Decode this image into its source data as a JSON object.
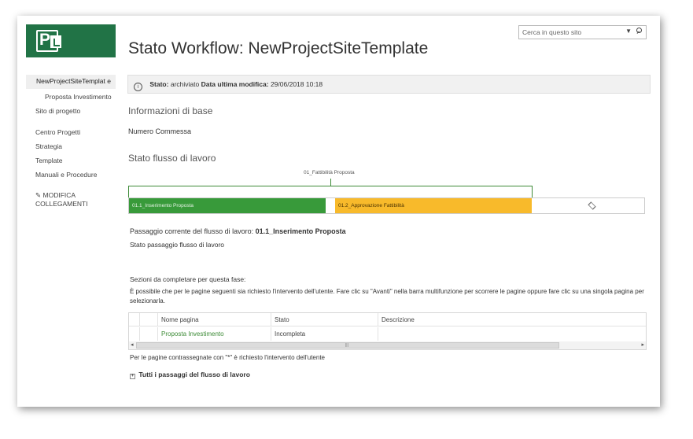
{
  "search": {
    "placeholder": "Cerca in questo sito"
  },
  "page": {
    "title": "Stato Workflow: NewProjectSiteTemplate"
  },
  "nav": {
    "items": [
      {
        "label": "NewProjectSiteTemplat e"
      },
      {
        "label": "Proposta Investimento"
      },
      {
        "label": "Sito di progetto"
      },
      {
        "label": "Centro Progetti"
      },
      {
        "label": "Strategia"
      },
      {
        "label": "Template"
      },
      {
        "label": "Manuali e Procedure"
      }
    ],
    "edit_links": "MODIFICA COLLEGAMENTI"
  },
  "status": {
    "label": "Stato:",
    "value": "archiviato",
    "modified_label": "Data ultima modifica:",
    "modified_value": "29/06/2018 10:18"
  },
  "basic_info": {
    "heading": "Informazioni di base",
    "field_link": "Numero Commessa"
  },
  "workflow": {
    "heading": "Stato flusso di lavoro",
    "callout": "01_Fattibilità Proposta",
    "stages": [
      {
        "label": "01.1_Inserimento Proposta",
        "color": "#389a3a"
      },
      {
        "label": "01.2_Approvazione Fattibilità",
        "color": "#f8ba2b"
      }
    ],
    "current_label": "Passaggio corrente del flusso di lavoro:",
    "current_value": "01.1_Inserimento Proposta",
    "status_label": "Stato passaggio flusso di lavoro"
  },
  "sections": {
    "heading": "Sezioni da completare per questa fase:",
    "description": "È possibile che per le pagine seguenti sia richiesto l'intervento dell'utente. Fare clic su \"Avanti\" nella barra multifunzione per scorrere le pagine oppure fare clic su una singola pagina per selezionarla.",
    "columns": [
      "Nome pagina",
      "Stato",
      "Descrizione"
    ],
    "rows": [
      {
        "name": "Proposta Investimento",
        "status": "Incompleta",
        "description": ""
      }
    ],
    "footnote": "Per le pagine contrassegnate con \"*\" è richiesto l'intervento dell'utente",
    "all_steps": "Tutti i passaggi del flusso di lavoro"
  }
}
